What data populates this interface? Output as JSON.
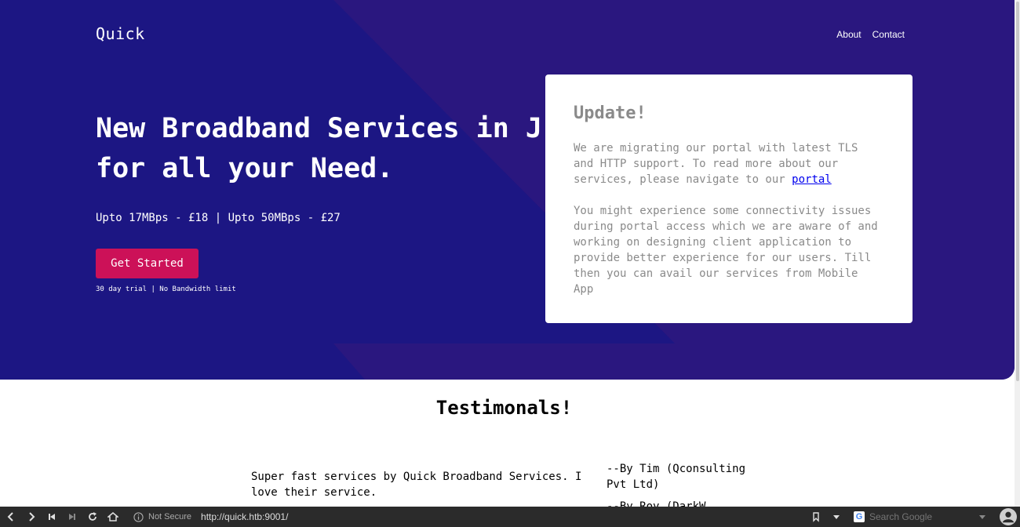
{
  "site": {
    "brand": "Quick",
    "nav": [
      {
        "label": "About"
      },
      {
        "label": "Contact"
      }
    ]
  },
  "hero": {
    "headline": "New Broadband Services in J\nfor all your Need.",
    "pricing": "Upto 17MBps - £18 | Upto 50MBps - £27",
    "cta_label": "Get Started",
    "trial_note": "30 day trial | No Bandwidth limit"
  },
  "update_card": {
    "title": "Update!",
    "para1_text": "We are migrating our portal with latest TLS and HTTP support. To read more about our services, please navigate to our ",
    "para1_link": "portal",
    "para2": "You might experience some connectivity issues during portal access which we are aware of and working on designing client application to provide better experience for our users. Till then you can avail our services from Mobile App"
  },
  "testimonials": {
    "title": "Testimonals!",
    "quote": "Super fast services by Quick Broadband Services. I love their service.",
    "author": "--By Tim (Qconsulting Pvt Ltd)",
    "author2_partial": "--By Roy (DarkW"
  },
  "browser": {
    "security_label": "Not Secure",
    "url": "http://quick.htb:9001/",
    "search_placeholder": "Search Google",
    "search_engine_letter": "G"
  },
  "colors": {
    "hero_bg": "#1c1683",
    "hero_shape": "#2c1680",
    "cta_bg": "#cc1158"
  }
}
